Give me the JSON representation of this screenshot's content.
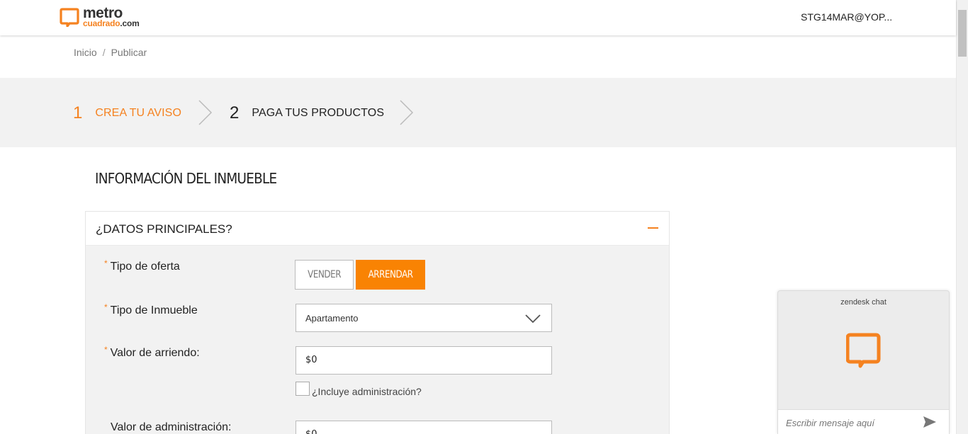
{
  "header": {
    "logo_top": "metro",
    "logo_bottom_orange": "cuadrado",
    "logo_bottom_dark": ".com",
    "user": "STG14MAR@YOP..."
  },
  "breadcrumb": {
    "items": [
      "Inicio",
      "Publicar"
    ],
    "separator": "/"
  },
  "steps": [
    {
      "number": "1",
      "label": "CREA TU AVISO",
      "active": true
    },
    {
      "number": "2",
      "label": "PAGA TUS PRODUCTOS",
      "active": false
    }
  ],
  "section_title": "INFORMACIÓN DEL INMUEBLE",
  "panel": {
    "title": "¿DATOS PRINCIPALES?",
    "required_mark": "*",
    "fields": {
      "tipo_oferta": {
        "label": "Tipo de oferta",
        "options": [
          "VENDER",
          "ARRENDAR"
        ],
        "selected": "ARRENDAR"
      },
      "tipo_inmueble": {
        "label": "Tipo de Inmueble",
        "value": "Apartamento"
      },
      "valor_arriendo": {
        "label": "Valor de arriendo:",
        "value": "$0"
      },
      "incluye_admin": {
        "label": "¿Incluye administración?",
        "checked": false
      },
      "valor_admin": {
        "label": "Valor de administración:",
        "value": "$0"
      }
    }
  },
  "chat": {
    "title": "zendesk chat",
    "placeholder": "Escribir mensaje aquí"
  },
  "colors": {
    "accent": "#f58220",
    "button_active": "#f98303",
    "stepper_bg": "#f2f2f2"
  },
  "icons": [
    "logo-icon",
    "chevron-right-icon",
    "minus-icon",
    "chevron-down-icon",
    "send-icon"
  ]
}
